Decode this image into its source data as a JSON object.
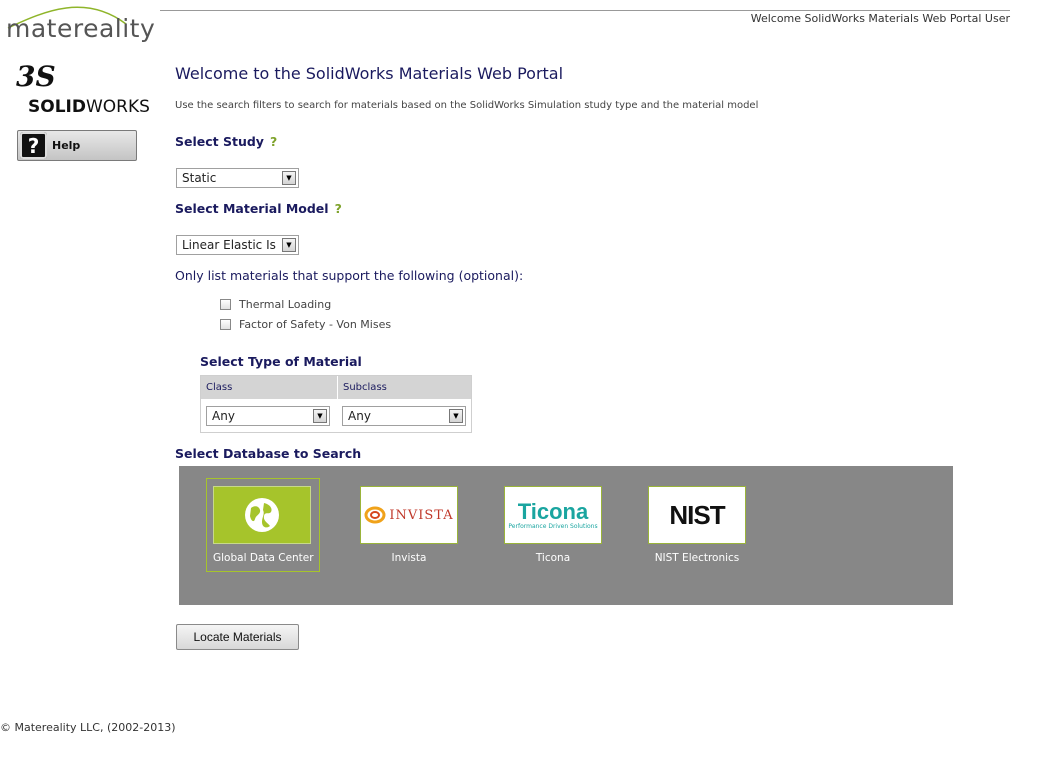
{
  "brand": {
    "logo_text": "matereality",
    "solidworks_mark": "3S",
    "solidworks_text_bold": "SOLID",
    "solidworks_text_light": "WORKS"
  },
  "help": {
    "label": "Help",
    "icon_glyph": "?"
  },
  "header": {
    "welcome_user": "Welcome SolidWorks Materials Web Portal User"
  },
  "main": {
    "title": "Welcome to the SolidWorks Materials Web Portal",
    "subtitle": "Use the search filters to search for materials based on the SolidWorks Simulation study type and the material model",
    "select_study": {
      "label": "Select Study",
      "help": "?",
      "value": "Static"
    },
    "select_model": {
      "label": "Select Material Model",
      "help": "?",
      "value": "Linear Elastic Iso"
    },
    "optional": {
      "label": "Only list materials that support the following (optional):",
      "options": [
        {
          "label": "Thermal Loading",
          "checked": false
        },
        {
          "label": "Factor of Safety - Von Mises",
          "checked": false
        }
      ]
    },
    "type_of_material": {
      "label": "Select Type of Material",
      "columns": [
        "Class",
        "Subclass"
      ],
      "class_value": "Any",
      "subclass_value": "Any"
    },
    "database": {
      "label": "Select Database to Search",
      "selected": "Global Data Center",
      "items": [
        {
          "label": "Global Data Center",
          "logo": "globe-icon"
        },
        {
          "label": "Invista",
          "logo_text": "INVISTA"
        },
        {
          "label": "Ticona",
          "logo_text": "Ticona",
          "logo_sub": "Performance Driven Solutions"
        },
        {
          "label": "NIST Electronics",
          "logo_text": "NIST"
        }
      ]
    },
    "locate_button": "Locate Materials"
  },
  "footer": {
    "copyright": "© Matereality LLC, (2002-2013)"
  },
  "colors": {
    "title_navy": "#1a1a5e",
    "accent_green": "#a6c42b",
    "panel_gray": "#878787"
  }
}
